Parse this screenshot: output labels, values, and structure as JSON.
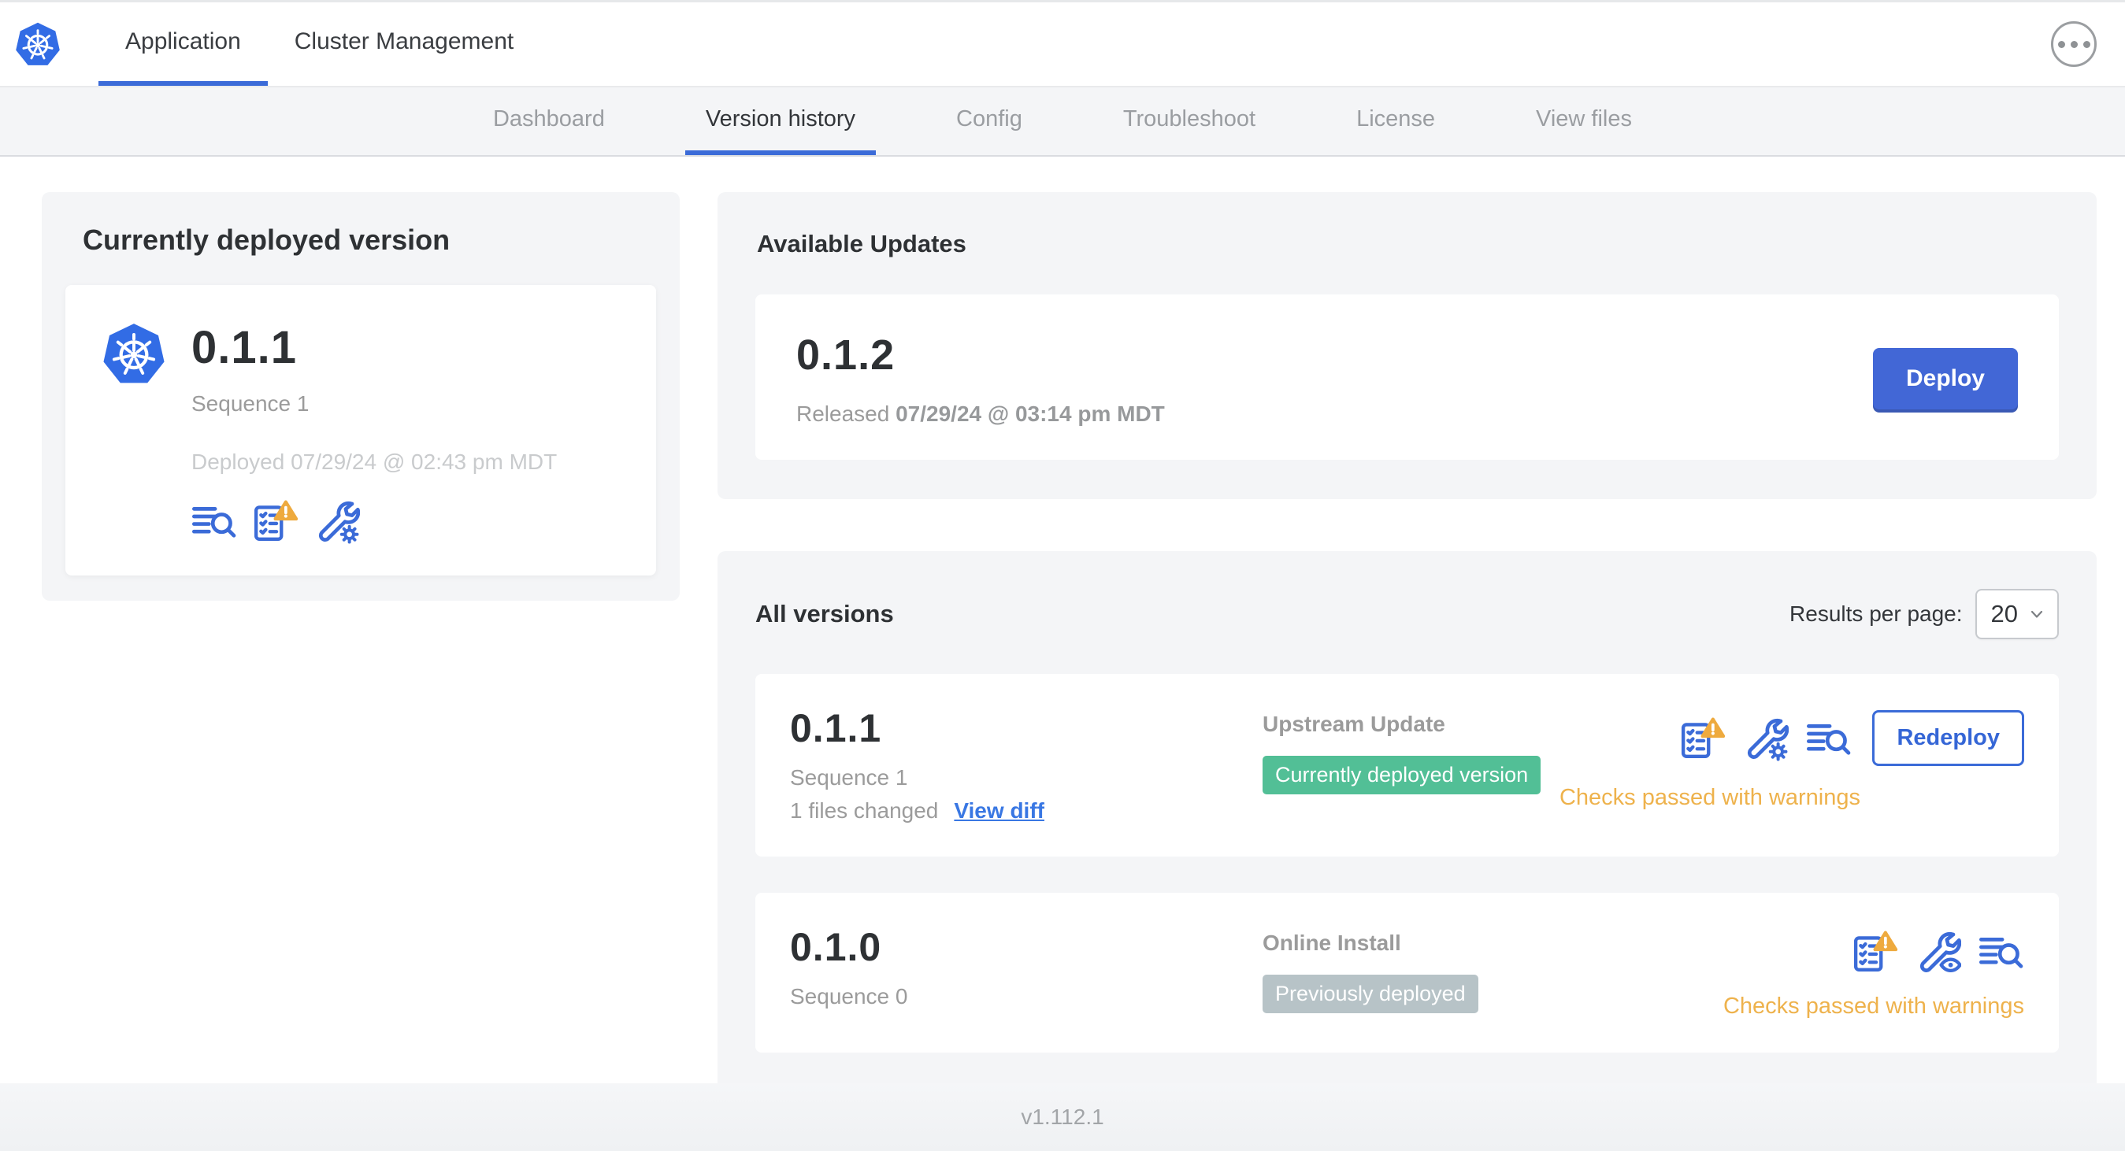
{
  "top_nav": {
    "logo_icon": "kubernetes-logo",
    "tabs": [
      {
        "label": "Application",
        "active": true
      },
      {
        "label": "Cluster Management",
        "active": false
      }
    ],
    "menu_icon": "ellipsis-icon"
  },
  "sub_nav": {
    "items": [
      {
        "label": "Dashboard",
        "active": false
      },
      {
        "label": "Version history",
        "active": true
      },
      {
        "label": "Config",
        "active": false
      },
      {
        "label": "Troubleshoot",
        "active": false
      },
      {
        "label": "License",
        "active": false
      },
      {
        "label": "View files",
        "active": false
      }
    ]
  },
  "currently_deployed": {
    "title": "Currently deployed version",
    "app_icon": "kubernetes-logo",
    "version": "0.1.1",
    "sequence": "Sequence 1",
    "deployed_at": "Deployed 07/29/24 @ 02:43 pm MDT",
    "icons": [
      "release-notes-icon",
      "preflight-checks-warning-icon",
      "edit-config-icon"
    ]
  },
  "available_updates": {
    "title": "Available Updates",
    "version": "0.1.2",
    "released_label": "Released",
    "released_date": "07/29/24 @ 03:14 pm MDT",
    "deploy_button": "Deploy"
  },
  "all_versions": {
    "title": "All versions",
    "results_per_page_label": "Results per page:",
    "results_per_page_value": "20",
    "rows": [
      {
        "version": "0.1.1",
        "sequence": "Sequence 1",
        "files_changed": "1 files changed",
        "view_diff_label": "View diff",
        "source": "Upstream Update",
        "badge": "Currently deployed version",
        "badge_color": "#52bf96",
        "icons": [
          "preflight-checks-warning-icon",
          "edit-config-icon",
          "release-notes-icon"
        ],
        "status": "Checks passed with warnings",
        "redeploy_button": "Redeploy"
      },
      {
        "version": "0.1.0",
        "sequence": "Sequence 0",
        "source": "Online Install",
        "badge": "Previously deployed",
        "badge_color": "#b7c3c7",
        "icons": [
          "preflight-checks-warning-icon",
          "view-config-icon",
          "release-notes-icon"
        ],
        "status": "Checks passed with warnings"
      }
    ]
  },
  "footer": {
    "version": "v1.112.1"
  },
  "colors": {
    "accent_blue": "#3b6bd8",
    "kubernetes_blue": "#326ce5",
    "deploy_button": "#4267d6",
    "badge_green": "#52bf96",
    "badge_gray": "#b7c3c7",
    "warning_amber": "#eeb24c",
    "panel_gray": "#f4f5f7",
    "muted_text": "#9b9b9b"
  }
}
